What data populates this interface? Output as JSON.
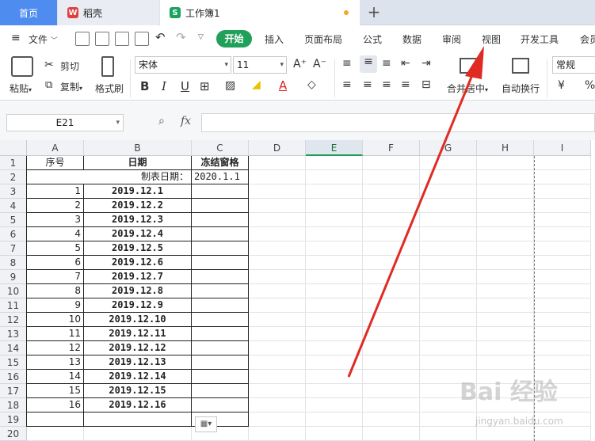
{
  "tabs": {
    "home": "首页",
    "doc": "稻壳",
    "doc_icon": "W",
    "workbook": "工作簿1",
    "workbook_icon": "S",
    "add": "+"
  },
  "menu": {
    "file": "文件",
    "start": "开始",
    "insert": "插入",
    "page_layout": "页面布局",
    "formula": "公式",
    "data": "数据",
    "review": "审阅",
    "view": "视图",
    "dev": "开发工具",
    "member": "会员"
  },
  "ribbon": {
    "paste": "粘贴",
    "cut": "剪切",
    "copy": "复制",
    "format_painter": "格式刷",
    "font_name": "宋体",
    "font_size": "11",
    "merge_center": "合并居中",
    "wrap_text": "自动换行",
    "number_format": "常规",
    "currency_symbol": "¥",
    "percent_symbol": "%",
    "bold": "B",
    "italic": "I",
    "underline": "U",
    "font_grow": "A⁺",
    "font_shrink": "A⁻"
  },
  "formula_bar": {
    "name_box": "E21",
    "fx": "fx",
    "formula": ""
  },
  "columns": [
    "A",
    "B",
    "C",
    "D",
    "E",
    "F",
    "G",
    "H",
    "I"
  ],
  "active_column": "E",
  "rows": [
    "1",
    "2",
    "3",
    "4",
    "5",
    "6",
    "7",
    "8",
    "9",
    "10",
    "11",
    "12",
    "13",
    "14",
    "15",
    "16",
    "17",
    "18",
    "19",
    "20"
  ],
  "sheet": {
    "header": {
      "seq": "序号",
      "date": "日期",
      "freeze": "冻结窗格"
    },
    "made_date_label": "制表日期：",
    "made_date_value": "2020.1.1",
    "records": [
      {
        "seq": "1",
        "date": "2019.12.1"
      },
      {
        "seq": "2",
        "date": "2019.12.2"
      },
      {
        "seq": "3",
        "date": "2019.12.3"
      },
      {
        "seq": "4",
        "date": "2019.12.4"
      },
      {
        "seq": "5",
        "date": "2019.12.5"
      },
      {
        "seq": "6",
        "date": "2019.12.6"
      },
      {
        "seq": "7",
        "date": "2019.12.7"
      },
      {
        "seq": "8",
        "date": "2019.12.8"
      },
      {
        "seq": "9",
        "date": "2019.12.9"
      },
      {
        "seq": "10",
        "date": "2019.12.10"
      },
      {
        "seq": "11",
        "date": "2019.12.11"
      },
      {
        "seq": "12",
        "date": "2019.12.12"
      },
      {
        "seq": "13",
        "date": "2019.12.13"
      },
      {
        "seq": "14",
        "date": "2019.12.14"
      },
      {
        "seq": "15",
        "date": "2019.12.15"
      },
      {
        "seq": "16",
        "date": "2019.12.16"
      }
    ]
  },
  "watermark": {
    "main": "Bai 经验",
    "sub": "jingyan.baidu.com"
  },
  "colors": {
    "accent_green": "#20a05a",
    "home_blue": "#4e8cef",
    "annotation_red": "#e02b22"
  }
}
